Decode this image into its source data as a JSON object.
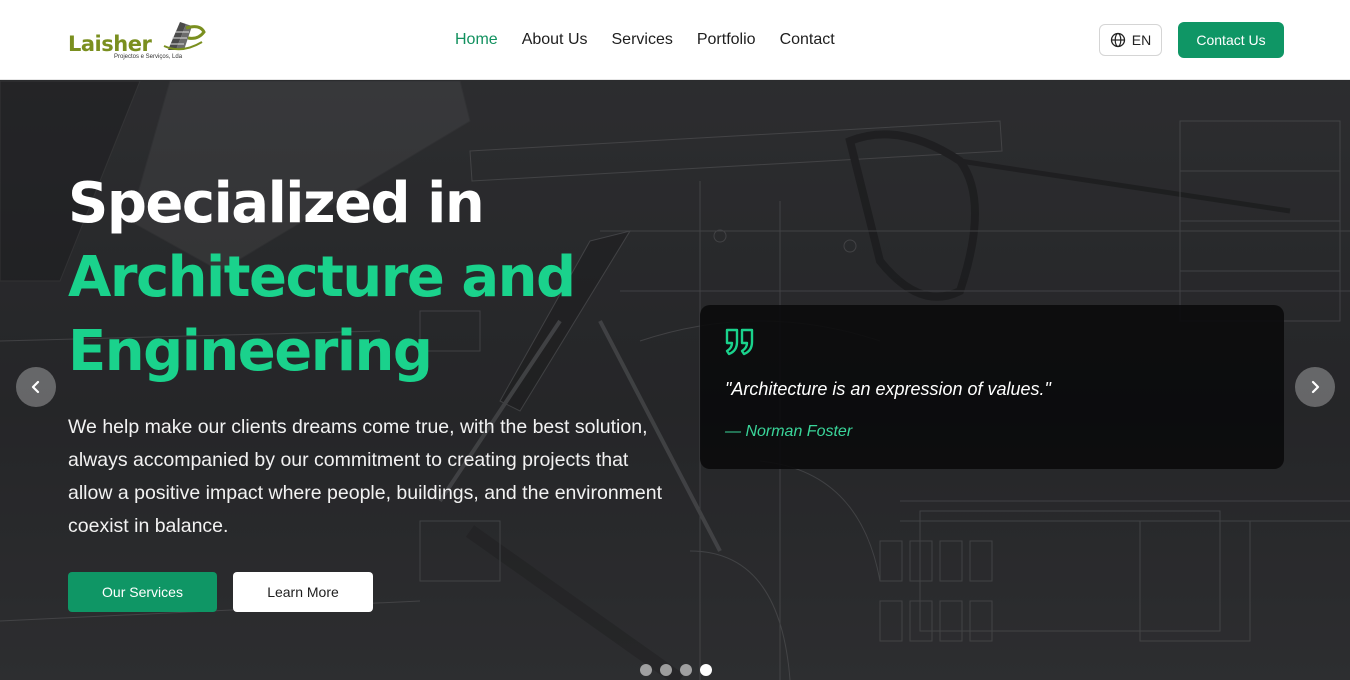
{
  "header": {
    "logo": {
      "word": "Laisher",
      "subtitle": "Projectos e Serviços, Lda"
    },
    "nav": [
      {
        "label": "Home",
        "active": true
      },
      {
        "label": "About Us",
        "active": false
      },
      {
        "label": "Services",
        "active": false
      },
      {
        "label": "Portfolio",
        "active": false
      },
      {
        "label": "Contact",
        "active": false
      }
    ],
    "language": {
      "label": "EN",
      "icon": "globe-icon"
    },
    "contact_button": "Contact Us"
  },
  "hero": {
    "headline_line1": "Specialized in",
    "headline_line2": "Architecture and",
    "headline_line3": "Engineering",
    "description": "We help make our clients dreams come true, with the best solution, always accompanied by our commitment to creating projects that allow a positive impact where people, buildings, and the environment coexist in balance.",
    "primary_button": "Our Services",
    "secondary_button": "Learn More",
    "quote": {
      "text": "\"Architecture is an expression of values.\"",
      "author": "— Norman Foster",
      "icon": "quote-icon"
    },
    "carousel": {
      "slide_count": 4,
      "active_index": 3,
      "prev_icon": "chevron-left-icon",
      "next_icon": "chevron-right-icon"
    }
  },
  "colors": {
    "accent": "#0f9665",
    "headline_accent": "#1ad28c",
    "quote_author": "#3ad59a"
  }
}
